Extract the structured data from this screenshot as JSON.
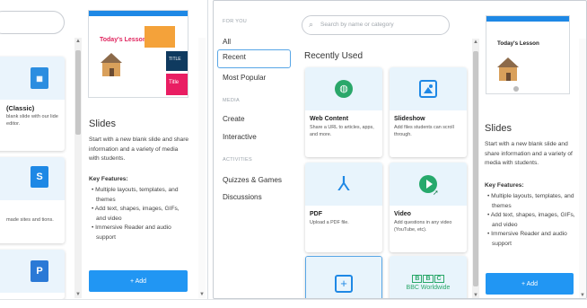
{
  "left": {
    "cards": [
      {
        "title": "(Classic)",
        "desc": "blank slide with our lide editor."
      },
      {
        "title": "",
        "desc": "made sites and tions."
      },
      {
        "title": "",
        "desc": ""
      }
    ],
    "preview": {
      "lesson": "Today's Lesson:",
      "tags": [
        "TITLE",
        "Title"
      ]
    },
    "detail": {
      "title": "Slides",
      "desc": "Start with a new blank slide and share information and a variety of media with students.",
      "key_features_label": "Key Features:",
      "features": [
        "Multiple layouts, templates, and themes",
        "Add text, shapes, images, GIFs, and video",
        "Immersive Reader and audio support"
      ],
      "add_label": "+ Add"
    }
  },
  "right": {
    "nav": {
      "section_for_you": "FOR YOU",
      "for_you_items": [
        "All",
        "Recent",
        "Most Popular"
      ],
      "section_media": "MEDIA",
      "media_items": [
        "Create",
        "Interactive"
      ],
      "section_activities": "ACTIVITIES",
      "activities_items": [
        "Quizzes & Games",
        "Discussions"
      ]
    },
    "search": {
      "placeholder": "Search by name or category"
    },
    "recently_used_title": "Recently Used",
    "tools": [
      {
        "name": "Web Content",
        "desc": "Share a URL to articles, apps, and more."
      },
      {
        "name": "Slideshow",
        "desc": "Add files students can scroll through."
      },
      {
        "name": "PDF",
        "desc": "Upload a PDF file."
      },
      {
        "name": "Video",
        "desc": "Add questions in any video (YouTube, etc)."
      },
      {
        "name": "",
        "desc": ""
      },
      {
        "name": "BBC Worldwide",
        "desc": ""
      }
    ],
    "preview": {
      "lesson": "Today's Lesson"
    },
    "detail": {
      "title": "Slides",
      "desc": "Start with a new blank slide and share information and a variety of media with students.",
      "key_features_label": "Key Features:",
      "features": [
        "Multiple layouts, templates, and themes",
        "Add text, shapes, images, GIFs, and video",
        "Immersive Reader and audio support"
      ],
      "add_label": "+ Add"
    }
  },
  "colors": {
    "accent": "#2196f3",
    "card_bg": "#e8f4fc",
    "web_content": "#2aa76a",
    "slideshow": "#1e88e5",
    "pdf": "#1e88e5",
    "video": "#26a96c",
    "bbc": "#2aa76a"
  }
}
